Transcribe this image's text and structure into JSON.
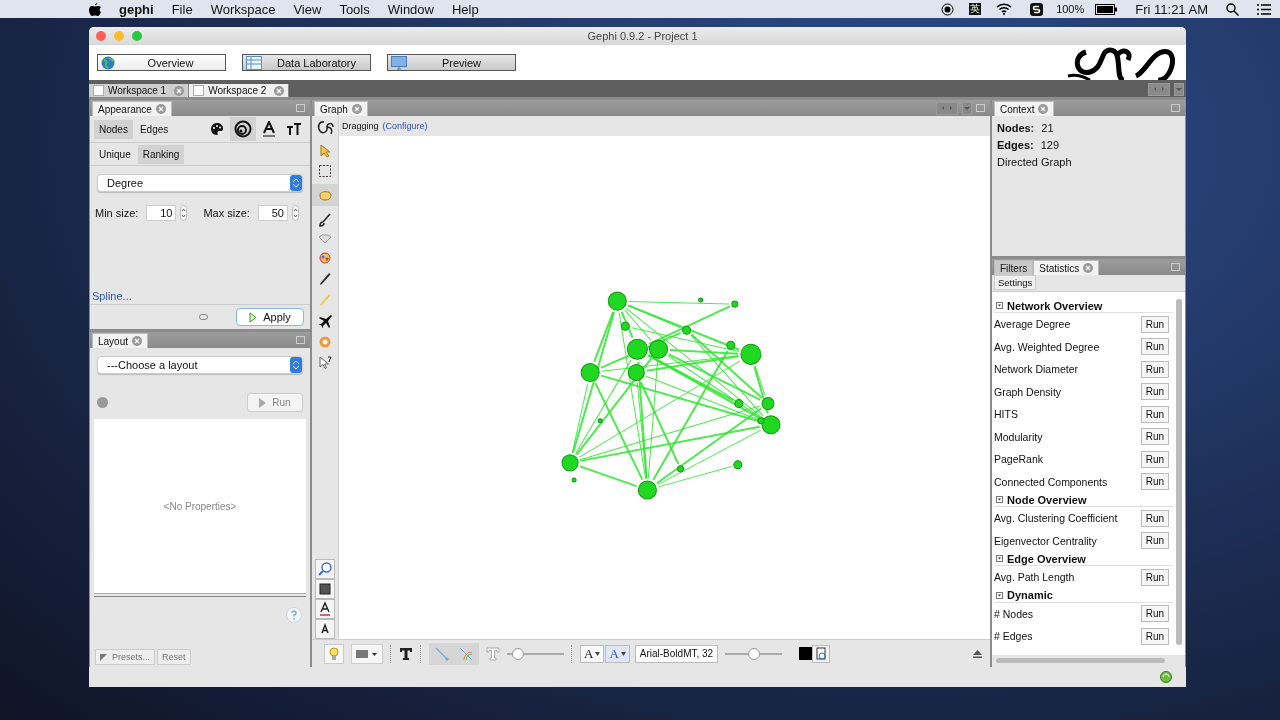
{
  "menubar": {
    "app": "gephi",
    "items": [
      "File",
      "Workspace",
      "View",
      "Tools",
      "Window",
      "Help"
    ],
    "input_method": "英",
    "battery": "100%",
    "clock": "Fri 11:21 AM"
  },
  "window": {
    "title": "Gephi 0.9.2 - Project 1"
  },
  "perspectives": [
    {
      "label": "Overview",
      "selected": true
    },
    {
      "label": "Data Laboratory",
      "selected": false
    },
    {
      "label": "Preview",
      "selected": false
    }
  ],
  "workspace_tabs": [
    {
      "label": "Workspace 1",
      "selected": false
    },
    {
      "label": "Workspace 2",
      "selected": true
    }
  ],
  "appearance": {
    "title": "Appearance",
    "target_tabs": [
      {
        "label": "Nodes",
        "selected": true
      },
      {
        "label": "Edges",
        "selected": false
      }
    ],
    "mode_tabs": [
      {
        "label": "Unique",
        "selected": false
      },
      {
        "label": "Ranking",
        "selected": true
      }
    ],
    "attribute": "Degree",
    "min_label": "Min size:",
    "min": "10",
    "max_label": "Max size:",
    "max": "50",
    "spline": "Spline...",
    "apply": "Apply"
  },
  "layout": {
    "title": "Layout",
    "select": "---Choose a layout",
    "run": {
      "label": "Run",
      "disabled": true
    },
    "empty": "<No Properties>",
    "presets": "Presets...",
    "reset": "Reset"
  },
  "graph": {
    "title": "Graph",
    "tool": "Dragging",
    "configure": "(Configure)",
    "font": "Arial-BoldMT, 32",
    "font_buttons": [
      "A",
      "A"
    ],
    "sliders": [
      {
        "level": 0.2
      },
      {
        "level": 0.5
      }
    ]
  },
  "context": {
    "title": "Context",
    "nodes_label": "Nodes:",
    "nodes": "21",
    "edges_label": "Edges:",
    "edges": "129",
    "type": "Directed Graph"
  },
  "statistics": {
    "tabs": [
      {
        "label": "Filters",
        "selected": false
      },
      {
        "label": "Statistics",
        "selected": true
      }
    ],
    "settings": "Settings",
    "groups": [
      {
        "title": "Network Overview",
        "expanded": true,
        "items": [
          {
            "name": "Average Degree",
            "run": "Run"
          },
          {
            "name": "Avg. Weighted Degree",
            "run": "Run"
          },
          {
            "name": "Network Diameter",
            "run": "Run"
          },
          {
            "name": "Graph Density",
            "run": "Run"
          },
          {
            "name": "HITS",
            "run": "Run"
          },
          {
            "name": "Modularity",
            "run": "Run"
          },
          {
            "name": "PageRank",
            "run": "Run"
          },
          {
            "name": "Connected Components",
            "run": "Run"
          }
        ]
      },
      {
        "title": "Node Overview",
        "expanded": true,
        "items": [
          {
            "name": "Avg. Clustering Coefficient",
            "run": "Run"
          },
          {
            "name": "Eigenvector Centrality",
            "run": "Run"
          }
        ]
      },
      {
        "title": "Edge Overview",
        "expanded": true,
        "items": [
          {
            "name": "Avg. Path Length",
            "run": "Run"
          }
        ]
      },
      {
        "title": "Dynamic",
        "expanded": true,
        "items": [
          {
            "name": "# Nodes",
            "run": "Run"
          },
          {
            "name": "# Edges",
            "run": "Run"
          }
        ]
      }
    ]
  }
}
